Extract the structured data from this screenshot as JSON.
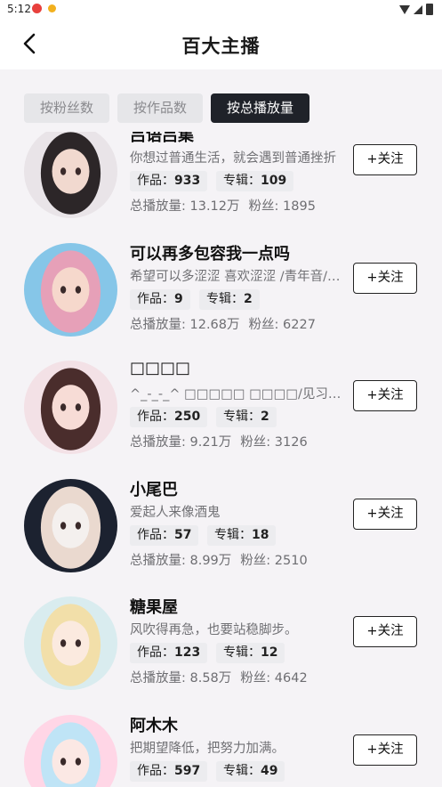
{
  "status_bar": {
    "time": "5:12"
  },
  "header": {
    "title": "百大主播"
  },
  "tabs": [
    {
      "label": "按粉丝数",
      "active": false
    },
    {
      "label": "按作品数",
      "active": false
    },
    {
      "label": "按总播放量",
      "active": true
    }
  ],
  "labels": {
    "works": "作品：",
    "albums": "专辑：",
    "plays": "总播放量: ",
    "fans": "粉丝: ",
    "follow": "+关注"
  },
  "anchors": [
    {
      "name": "吕语吕集",
      "desc": "你想过普通生活，就会遇到普通挫折",
      "works": "933",
      "albums": "109",
      "plays": "13.12万",
      "fans": "1895",
      "avatar_colors": [
        "#e9e4e8",
        "#2c2628",
        "#f1d9cf"
      ]
    },
    {
      "name": "可以再多包容我一点吗",
      "desc": "希望可以多涩涩 喜欢涩涩 /青年音/主播",
      "works": "9",
      "albums": "2",
      "plays": "12.68万",
      "fans": "6227",
      "avatar_colors": [
        "#86c6e8",
        "#e6a0b8",
        "#f6d8cc"
      ]
    },
    {
      "name": "□□□□",
      "desc": "^_-_-_^ □□□□□ □□□□/见习女喘/爱与和平",
      "works": "250",
      "albums": "2",
      "plays": "9.21万",
      "fans": "3126",
      "avatar_colors": [
        "#f3e1e6",
        "#4a2d2c",
        "#f7dcd6"
      ]
    },
    {
      "name": "小尾巴",
      "desc": "爱起人来像酒鬼",
      "works": "57",
      "albums": "18",
      "plays": "8.99万",
      "fans": "2510",
      "avatar_colors": [
        "#1c2230",
        "#ead9cf",
        "#f4f0ee"
      ]
    },
    {
      "name": "糖果屋",
      "desc": "风吹得再急，也要站稳脚步。",
      "works": "123",
      "albums": "12",
      "plays": "8.58万",
      "fans": "4642",
      "avatar_colors": [
        "#d9ecef",
        "#f2dfa9",
        "#fbeadf"
      ]
    },
    {
      "name": "阿木木",
      "desc": "把期望降低，把努力加满。",
      "works": "597",
      "albums": "49",
      "plays": "",
      "fans": "",
      "avatar_colors": [
        "#ffd6e6",
        "#bfe4f6",
        "#fbe8e4"
      ]
    }
  ]
}
